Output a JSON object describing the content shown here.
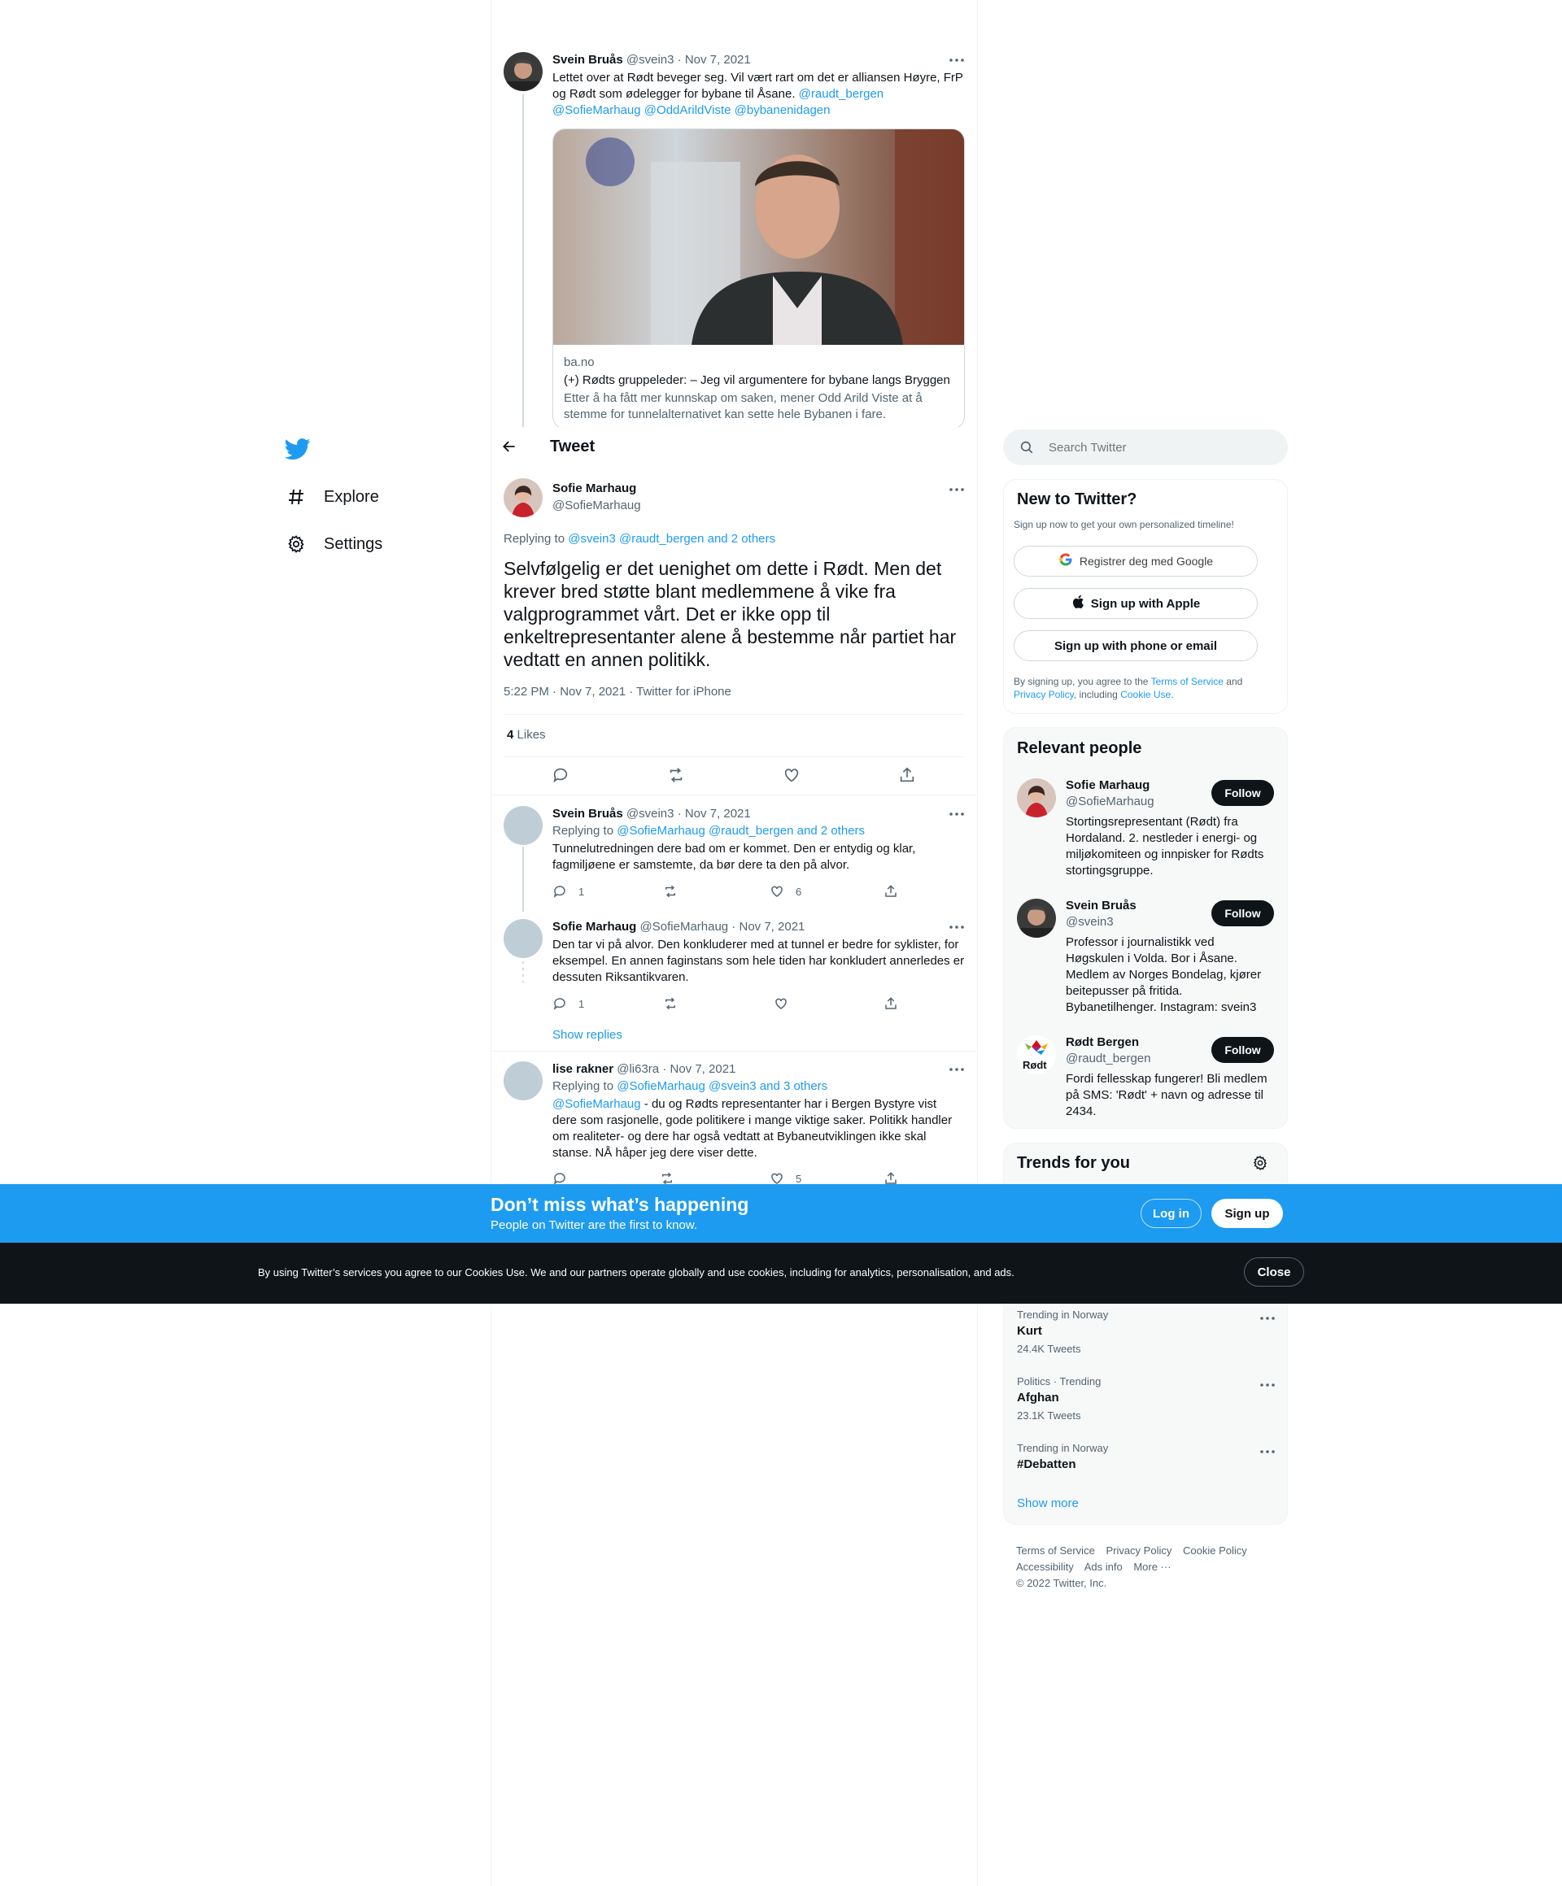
{
  "nav": {
    "items": [
      {
        "label": "Explore",
        "icon": "hashtag-icon"
      },
      {
        "label": "Settings",
        "icon": "gear-icon"
      }
    ]
  },
  "parent_tweet": {
    "name": "Svein Bruås",
    "handle": "@svein3",
    "date": "Nov 7, 2021",
    "text": "Lettet over at Rødt beveger seg. Vil vært rart om det er alliansen Høyre, FrP og Rødt som ødelegger for bybane til Åsane.",
    "mentions": [
      "@raudt_bergen",
      "@SofieMarhaug",
      "@OddArildViste",
      "@bybanenidagen"
    ],
    "card": {
      "domain": "ba.no",
      "title": "(+) Rødts gruppeleder: – Jeg vil argumentere for bybane langs Bryggen",
      "description": "Etter å ha fått mer kunnskap om saken, mener Odd Arild Viste at å stemme for tunnelalternativet kan sette hele Bybanen i fare."
    }
  },
  "header": {
    "title": "Tweet"
  },
  "main_tweet": {
    "name": "Sofie Marhaug",
    "handle": "@SofieMarhaug",
    "replying_prefix": "Replying to",
    "replying_to": "@svein3 @raudt_bergen and 2 others",
    "text": "Selvfølgelig er det uenighet om dette i Rødt. Men det krever bred støtte blant medlemmene å vike fra valgprogrammet vårt. Det er ikke opp til enkeltrepresentanter alene å bestemme når partiet har vedtatt en annen politikk.",
    "meta": "5:22 PM · Nov 7, 2021 · Twitter for iPhone",
    "likes_count": "4",
    "likes_label": "Likes"
  },
  "replies": [
    {
      "name": "Svein Bruås",
      "handle": "@svein3",
      "date": "Nov 7, 2021",
      "replying_prefix": "Replying to",
      "replying_to": "@SofieMarhaug @raudt_bergen and 2 others",
      "text": "Tunnelutredningen dere bad om er kommet. Den er entydig og klar, fagmiljøene er samstemte, da bør dere ta den på alvor.",
      "reply_count": "1",
      "retweet_count": "",
      "like_count": "6"
    },
    {
      "name": "Sofie Marhaug",
      "handle": "@SofieMarhaug",
      "date": "Nov 7, 2021",
      "text": "Den tar vi på alvor. Den konkluderer med at tunnel er bedre for syklister, for eksempel. En annen faginstans som hele tiden har konkludert annerledes er dessuten Riksantikvaren.",
      "reply_count": "1",
      "retweet_count": "",
      "like_count": "",
      "show_replies": "Show replies"
    },
    {
      "name": "lise rakner",
      "handle": "@li63ra",
      "date": "Nov 7, 2021",
      "replying_prefix": "Replying to",
      "replying_to": "@SofieMarhaug @svein3 and 3 others",
      "mention": "@SofieMarhaug",
      "text": " - du og Rødts representanter har i Bergen Bystyre vist dere som rasjonelle, gode politikere i mange  viktige saker. Politikk handler om realiteter- og dere har også vedtatt at Bybaneutviklingen ikke skal stanse. NÅ håper jeg dere viser dette.",
      "reply_count": "",
      "retweet_count": "",
      "like_count": "5"
    }
  ],
  "search": {
    "placeholder": "Search Twitter"
  },
  "new_to_twitter": {
    "title": "New to Twitter?",
    "subtitle": "Sign up now to get your own personalized timeline!",
    "google": "Registrer deg med Google",
    "apple": "Sign up with Apple",
    "phone": "Sign up with phone or email",
    "legal_prefix": "By signing up, you agree to the",
    "terms": "Terms of Service",
    "and": "and",
    "privacy": "Privacy Policy",
    "including": ", including",
    "cookie": "Cookie Use."
  },
  "relevant_people": {
    "title": "Relevant people",
    "follow_label": "Follow",
    "people": [
      {
        "name": "Sofie Marhaug",
        "handle": "@SofieMarhaug",
        "bio": "Stortingsrepresentant (Rødt) fra Hordaland. 2. nestleder i energi- og miljøkomiteen og innpisker for Rødts stortingsgruppe."
      },
      {
        "name": "Svein Bruås",
        "handle": "@svein3",
        "bio": "Professor i journalistikk ved Høgskulen i Volda. Bor i Åsane. Medlem av Norges Bondelag, kjører beitepusser på fritida. Bybanetilhenger. Instagram: svein3"
      },
      {
        "name": "Rødt Bergen",
        "handle": "@raudt_bergen",
        "bio": "Fordi fellesskap fungerer! Bli medlem på SMS: 'Rødt' + navn og adresse til 2434."
      }
    ]
  },
  "trends": {
    "title": "Trends for you",
    "items": [
      {
        "meta": "Trending in Norway",
        "name": "Kurt",
        "count": "24.4K Tweets"
      },
      {
        "meta": "Politics · Trending",
        "name": "Afghan",
        "count": "23.1K Tweets"
      },
      {
        "meta": "Trending in Norway",
        "name": "#Debatten",
        "count": ""
      }
    ],
    "show_more": "Show more"
  },
  "footer": {
    "links": [
      "Terms of Service",
      "Privacy Policy",
      "Cookie Policy",
      "Accessibility",
      "Ads info",
      "More ···"
    ],
    "copyright": "© 2022 Twitter, Inc."
  },
  "banner": {
    "title": "Don’t miss what’s happening",
    "subtitle": "People on Twitter are the first to know.",
    "login": "Log in",
    "signup": "Sign up"
  },
  "cookie_bar": {
    "text": "By using Twitter’s services you agree to our Cookies Use. We and our partners operate globally and use cookies, including for analytics, personalisation, and ads.",
    "close": "Close"
  },
  "logo_text": "Rødt",
  "colors": {
    "accent": "#1d9bf0",
    "dark": "#0f1419",
    "muted": "#536471"
  }
}
